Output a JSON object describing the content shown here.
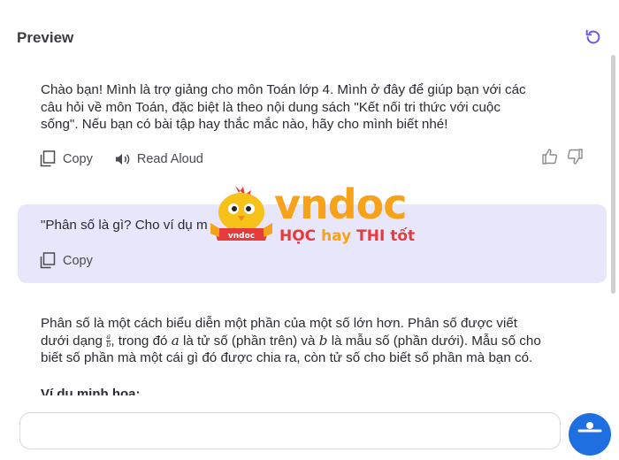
{
  "header": {
    "title": "Preview"
  },
  "assistant_msg_1": {
    "lines": [
      "Chào bạn! Mình là trợ giảng cho môn Toán lớp 4. Mình ở đây để giúp bạn với các",
      "câu hỏi về môn Toán, đặc biệt là theo nội dung sách \"Kết nối tri thức với cuộc",
      "sống\". Nếu bạn có bài tập hay thắc mắc nào, hãy cho mình biết nhé!"
    ],
    "copy_label": "Copy",
    "read_aloud_label": "Read Aloud"
  },
  "user_msg": {
    "text": "\"Phân số là gì? Cho ví dụ m",
    "copy_label": "Copy"
  },
  "assistant_msg_2": {
    "line1": "Phân số là một cách biểu diễn một phần của một số lớn hơn. Phân số được viết",
    "line2_a": "dưới dạng",
    "frac_num": "a",
    "frac_den": "b",
    "line2_b": ", trong đó",
    "var_a": "a",
    "line2_c": "là tử số (phần trên) và",
    "var_b": "b",
    "line2_d": "là mẫu số (phần dưới). Mẫu số cho",
    "line3": "biết số phần mà một cái gì đó được chia ra, còn tử số cho biết số phần mà bạn có.",
    "example_heading": "Ví dụ minh họa:"
  },
  "watermark": {
    "word": "vndoc",
    "badge": "vndoc",
    "tagline_1": "HỌC",
    "tagline_2": "hay",
    "tagline_3": "THI tốt"
  },
  "colors": {
    "accent": "#6b5ce7",
    "bubble": "#e8e6fb",
    "access_button": "#1e6fe0"
  }
}
